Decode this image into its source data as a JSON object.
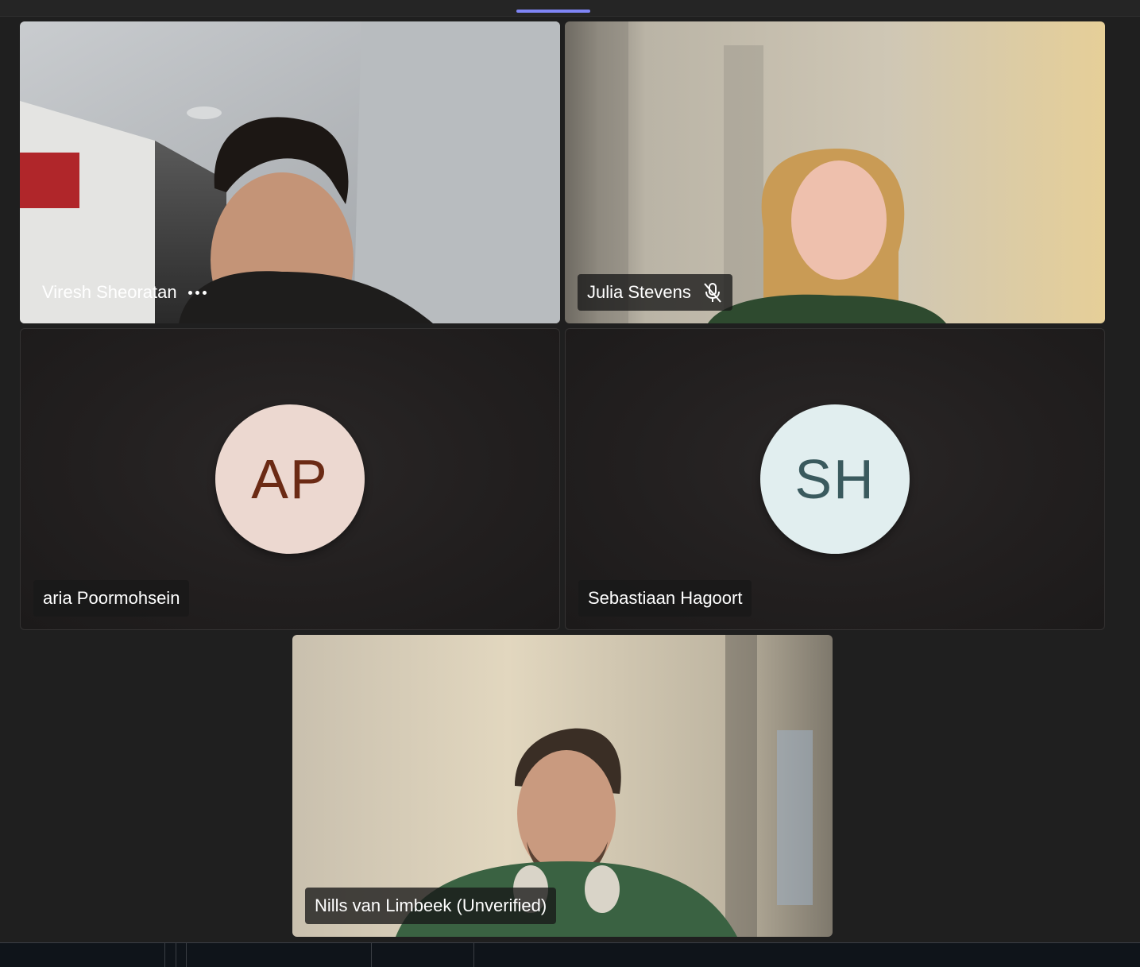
{
  "meeting": {
    "participants": [
      {
        "name": "Viresh Sheoratan",
        "video": true,
        "more_icon": "more-options-icon"
      },
      {
        "name": "Julia Stevens",
        "video": true,
        "muted": true,
        "mic_icon": "mic-off-icon"
      },
      {
        "name": "aria Poormohsein",
        "video": false,
        "initials": "AP",
        "avatar_bg": "#ecd8d0",
        "avatar_fg": "#6b2a14"
      },
      {
        "name": "Sebastiaan Hagoort",
        "video": false,
        "initials": "SH",
        "avatar_bg": "#e1eeef",
        "avatar_fg": "#3a5a5e"
      },
      {
        "name": "Nills van Limbeek (Unverified)",
        "video": true
      }
    ]
  },
  "colors": {
    "background": "#1f1f1f",
    "tab_indicator": "#7f85f5"
  }
}
